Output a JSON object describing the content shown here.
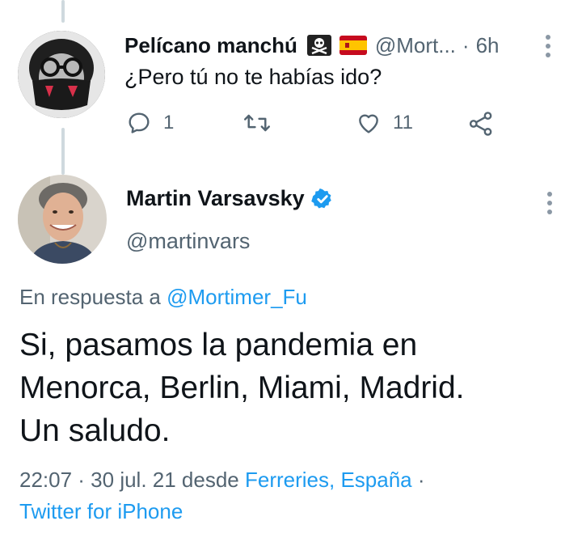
{
  "reply_tweet": {
    "display_name": "Pelícano manchú",
    "handle_truncated": "@Mort...",
    "separator": "·",
    "time_ago": "6h",
    "text": "¿Pero tú no te habías ido?",
    "reply_count": "1",
    "like_count": "11"
  },
  "main_tweet": {
    "display_name": "Martin Varsavsky",
    "handle": "@martinvars",
    "replying_prefix": "En respuesta a",
    "replying_to": "@Mortimer_Fu",
    "text_lines": [
      "Si, pasamos la pandemia en",
      "Menorca, Berlin, Miami, Madrid.",
      "Un saludo."
    ],
    "timestamp": "22:07 · 30 jul. 21 desde",
    "location": "Ferreries, España",
    "dot_sep": "·",
    "source": "Twitter for iPhone"
  },
  "colors": {
    "accent": "#1d9bf0",
    "muted": "#536471",
    "text": "#0f1419"
  }
}
